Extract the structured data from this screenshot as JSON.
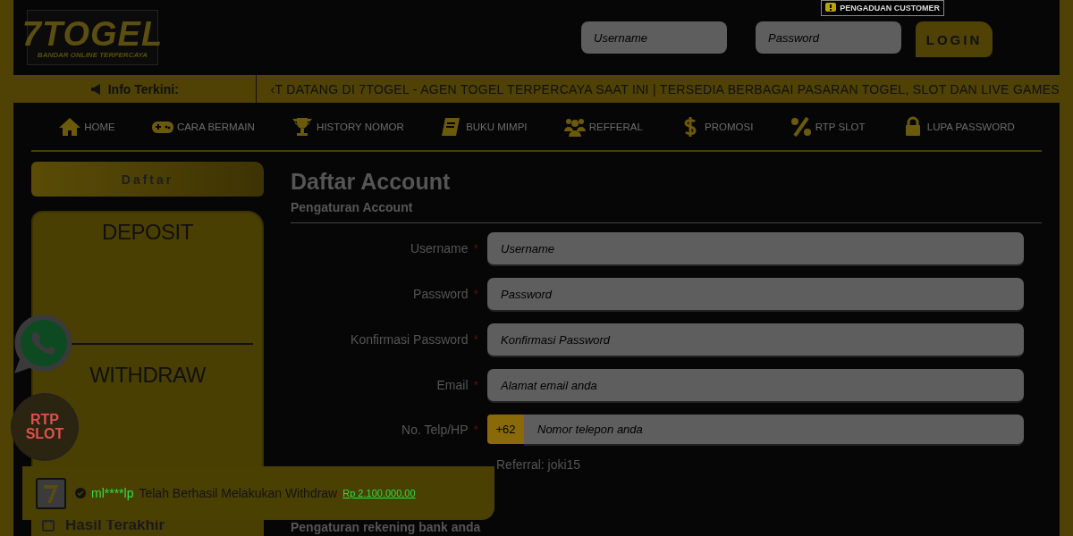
{
  "header": {
    "logo": {
      "text": "7TOGEL",
      "tagline": "BANDAR ONLINE TERPERCAYA"
    },
    "complaint_badge": "PENGADUAN CUSTOMER",
    "login_fields": [
      {
        "placeholder": "Username"
      },
      {
        "placeholder": "Password"
      }
    ],
    "login_button": "LOGIN"
  },
  "ticker": {
    "label": "Info Terkini:",
    "text": "‹T DATANG DI 7TOGEL - AGEN TOGEL TERPERCAYA SAAT INI | TERSEDIA BERBAGAI PASARAN TOGEL, SLOT DAN LIVE GAMES"
  },
  "nav": [
    {
      "label": "HOME",
      "kind": "home"
    },
    {
      "label": "CARA BERMAIN",
      "kind": "gamepad"
    },
    {
      "label": "HISTORY NOMOR",
      "kind": "trophy"
    },
    {
      "label": "BUKU MIMPI",
      "kind": "book"
    },
    {
      "label": "REFFERAL",
      "kind": "users"
    },
    {
      "label": "PROMOSI",
      "kind": "dollar"
    },
    {
      "label": "RTP SLOT",
      "kind": "percent"
    },
    {
      "label": "LUPA PASSWORD",
      "kind": "lock"
    }
  ],
  "sidebar": {
    "tab": "Daftar",
    "sections": [
      "DEPOSIT",
      "WITHDRAW"
    ],
    "results_title": "Hasil Terakhir"
  },
  "form": {
    "title": "Daftar Account",
    "subtitle": "Pengaturan Account",
    "fields": [
      {
        "label": "Username",
        "required": true,
        "placeholder": "Username",
        "kind": "text"
      },
      {
        "label": "Password",
        "required": true,
        "placeholder": "Password",
        "kind": "text"
      },
      {
        "label": "Konfirmasi Password",
        "required": true,
        "placeholder": "Konfirmasi Password",
        "kind": "text"
      },
      {
        "label": "Email",
        "required": true,
        "placeholder": "Alamat email anda",
        "kind": "text"
      },
      {
        "label": "No. Telp/HP",
        "required": true,
        "placeholder": "Nomor telepon anda",
        "kind": "phone",
        "prefix": "+62"
      }
    ],
    "required_mark": "*",
    "referral": "Referral: joki15",
    "bank_section": "Pengaturan rekening bank anda"
  },
  "floating": {
    "rtp_badge": {
      "line1": "RTP",
      "line2": "SLOT"
    }
  },
  "toast": {
    "user": "ml****lp",
    "message": "Telah Berhasil Melakukan Withdraw",
    "amount": "Rp 2.100.000,00"
  }
}
